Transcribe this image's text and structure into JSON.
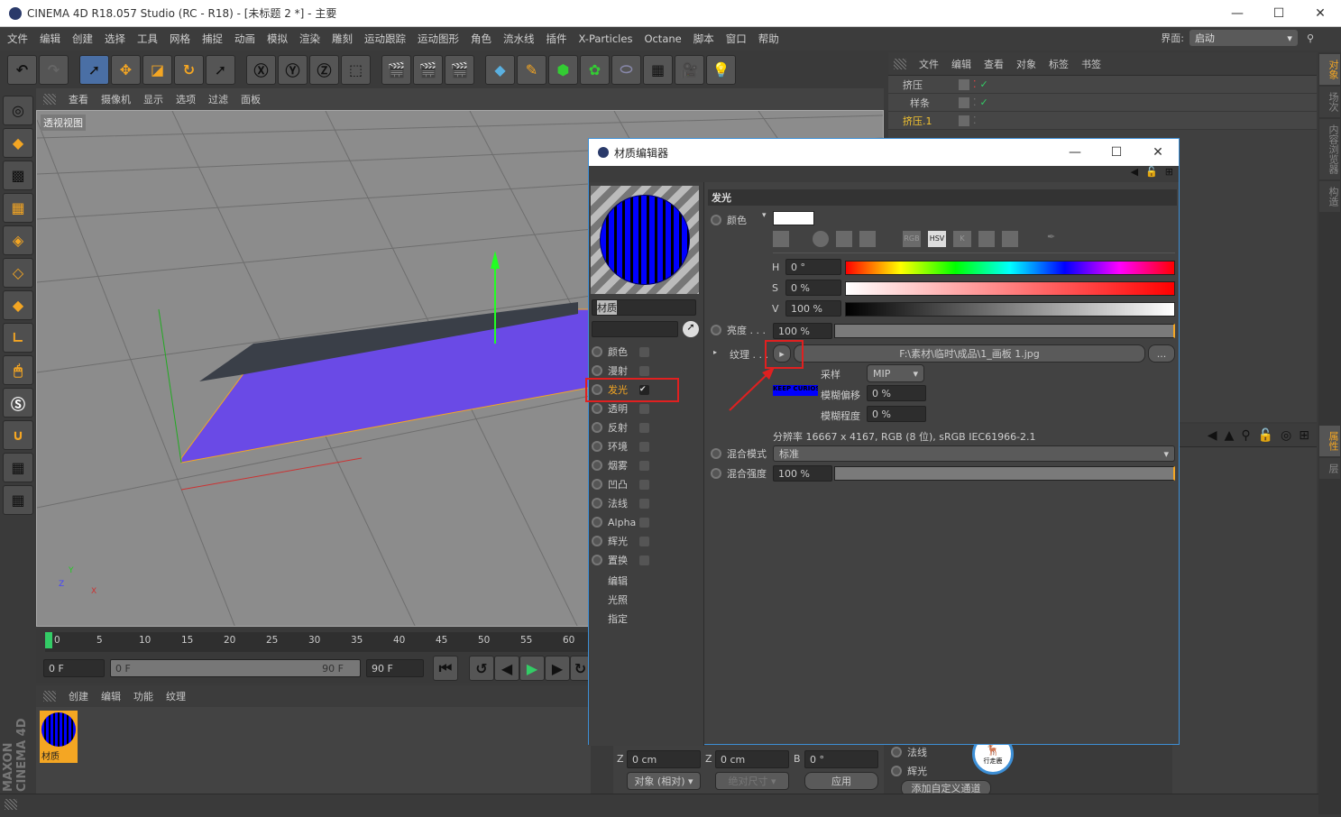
{
  "window": {
    "title": "CINEMA 4D R18.057 Studio (RC - R18) - [未标题 2 *] - 主要",
    "min": "—",
    "max": "☐",
    "close": "✕"
  },
  "menu": [
    "文件",
    "编辑",
    "创建",
    "选择",
    "工具",
    "网格",
    "捕捉",
    "动画",
    "模拟",
    "渲染",
    "雕刻",
    "运动跟踪",
    "运动图形",
    "角色",
    "流水线",
    "插件",
    "X-Particles",
    "Octane",
    "脚本",
    "窗口",
    "帮助"
  ],
  "layout": {
    "label": "界面:",
    "value": "启动"
  },
  "viewport": {
    "menu": [
      "查看",
      "摄像机",
      "显示",
      "选项",
      "过滤",
      "面板"
    ],
    "label": "透视视图",
    "axes": {
      "x": "X",
      "y": "Y",
      "z": "Z"
    }
  },
  "object_manager": {
    "menu": [
      "文件",
      "编辑",
      "查看",
      "对象",
      "标签",
      "书签"
    ],
    "objects": [
      {
        "name": "挤压",
        "color": "#c8c8c8"
      },
      {
        "name": "样条",
        "color": "#c8c8c8"
      },
      {
        "name": "挤压.1",
        "color": "#f4c430"
      }
    ]
  },
  "side_tabs": [
    "对象",
    "场次",
    "内容浏览器",
    "构造"
  ],
  "attr_tabs": [
    "属性",
    "层"
  ],
  "timeline": {
    "ticks": [
      "0",
      "5",
      "10",
      "15",
      "20",
      "25",
      "30",
      "35",
      "40",
      "45",
      "50",
      "55",
      "60"
    ],
    "current": "0 F",
    "range_start": "0 F",
    "range_end": "90 F",
    "end": "90 F",
    "progress_percent": 0
  },
  "material_manager": {
    "menu": [
      "创建",
      "编辑",
      "功能",
      "纹理"
    ],
    "material_name": "材质"
  },
  "material_editor": {
    "title": "材质编辑器",
    "name": "材质",
    "channels": [
      {
        "label": "颜色",
        "checked": false
      },
      {
        "label": "漫射",
        "checked": false
      },
      {
        "label": "发光",
        "checked": true,
        "active": true
      },
      {
        "label": "透明",
        "checked": false
      },
      {
        "label": "反射",
        "checked": false
      },
      {
        "label": "环境",
        "checked": false
      },
      {
        "label": "烟雾",
        "checked": false
      },
      {
        "label": "凹凸",
        "checked": false
      },
      {
        "label": "法线",
        "checked": false
      },
      {
        "label": "Alpha",
        "checked": false
      },
      {
        "label": "辉光",
        "checked": false
      },
      {
        "label": "置换",
        "checked": false
      }
    ],
    "extra": [
      "编辑",
      "光照",
      "指定"
    ],
    "section": "发光",
    "color_label": "颜色",
    "color_value": "#ffffff",
    "color_modes": [
      "RGB",
      "HSV",
      "K"
    ],
    "h": {
      "label": "H",
      "value": "0 °"
    },
    "s": {
      "label": "S",
      "value": "0 %"
    },
    "v": {
      "label": "V",
      "value": "100 %"
    },
    "brightness": {
      "label": "亮度 . . .",
      "value": "100 %",
      "percent": 100
    },
    "texture": {
      "label": "纹理 . . .",
      "path": "F:\\素材\\临时\\成品\\1_画板 1.jpg",
      "browse": "..."
    },
    "sampling": {
      "label": "采样",
      "value": "MIP"
    },
    "blur_offset": {
      "label": "模糊偏移",
      "value": "0 %"
    },
    "blur_scale": {
      "label": "模糊程度",
      "value": "0 %"
    },
    "preview_text": "KEEP CURIOSITY",
    "resolution": "分辨率 16667 x 4167, RGB (8 位), sRGB IEC61966-2.1",
    "blend_mode": {
      "label": "混合模式",
      "value": "标准"
    },
    "blend_strength": {
      "label": "混合强度",
      "value": "100 %",
      "percent": 100
    }
  },
  "coords": {
    "z1_label": "Z",
    "z1": "0 cm",
    "z2_label": "Z",
    "z2": "0 cm",
    "b_label": "B",
    "b": "0 °",
    "mode": "对象 (相对)",
    "size": "绝对尺寸",
    "apply": "应用"
  },
  "channel_panel": {
    "items": [
      "法线",
      "辉光"
    ],
    "add": "添加自定义通道"
  },
  "watermark": "行走鹿",
  "brand": "MAXON CINEMA 4D"
}
